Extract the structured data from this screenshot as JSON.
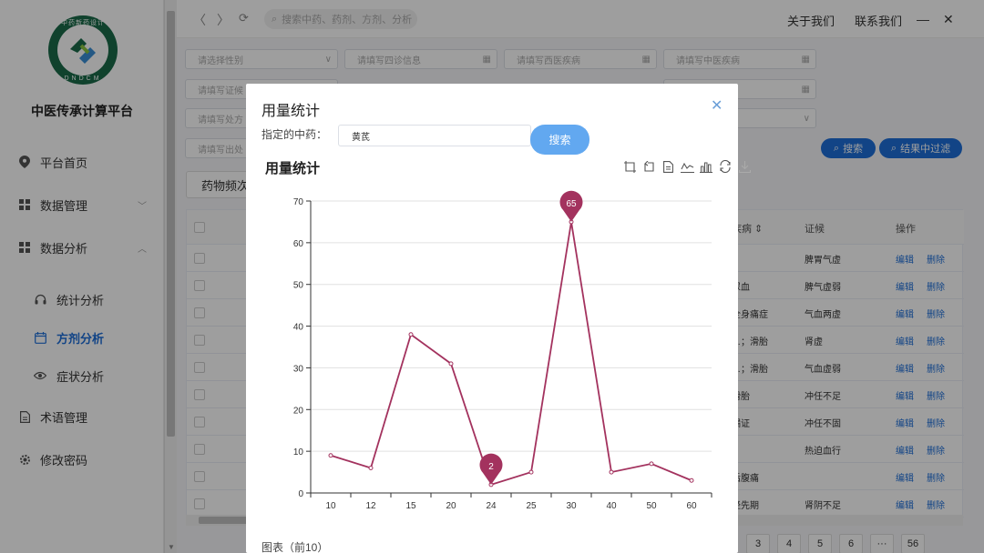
{
  "sidebar": {
    "brand": "中医传承计算平台",
    "logo": {
      "ring_top": "中药新药设计",
      "ring_bottom": "DNDCM"
    },
    "items": [
      {
        "label": "平台首页",
        "icon": "location-pin-icon"
      },
      {
        "label": "数据管理",
        "icon": "grid-icon"
      },
      {
        "label": "数据分析",
        "icon": "grid-icon"
      },
      {
        "label": "统计分析",
        "icon": "headset-icon"
      },
      {
        "label": "方剂分析",
        "icon": "calendar-icon"
      },
      {
        "label": "症状分析",
        "icon": "eye-icon"
      },
      {
        "label": "术语管理",
        "icon": "document-icon"
      },
      {
        "label": "修改密码",
        "icon": "gear-icon"
      }
    ]
  },
  "topbar": {
    "search_placeholder": "搜索中药、药剂、方剂、分析",
    "links": [
      "关于我们",
      "联系我们"
    ]
  },
  "filters": {
    "row1": [
      "请选择性别",
      "请填写四诊信息",
      "请填写西医疾病",
      "请填写中医疾病"
    ],
    "row2": [
      "请填写证候"
    ],
    "row3": [
      "请填写处方"
    ],
    "row4": [
      "请填写出处"
    ],
    "search_btn": "搜索",
    "filter_btn": "结果中过滤"
  },
  "tab_chip": "药物频次",
  "table": {
    "headers": [
      "疾病",
      "证候",
      "操作"
    ],
    "rows": [
      {
        "disease": "",
        "syndrome": "脾胃气虚"
      },
      {
        "disease": "尿血",
        "syndrome": "脾气虚弱"
      },
      {
        "disease": "全身痛症",
        "syndrome": "气血两虚"
      },
      {
        "disease": "…；滑胎",
        "syndrome": "肾虚"
      },
      {
        "disease": "…；滑胎",
        "syndrome": "气血虚弱"
      },
      {
        "disease": "滑胎",
        "syndrome": "冲任不足"
      },
      {
        "disease": "漏证",
        "syndrome": "冲任不固"
      },
      {
        "disease": "",
        "syndrome": "热迫血行"
      },
      {
        "disease": "后腹痛",
        "syndrome": ""
      },
      {
        "disease": "经先期",
        "syndrome": "肾阴不足"
      }
    ],
    "edit": "编辑",
    "delete": "删除"
  },
  "pager": [
    "3",
    "4",
    "5",
    "6",
    "···",
    "56"
  ],
  "modal": {
    "title": "用量统计",
    "label": "指定的中药：",
    "input_value": "黄芪",
    "search_btn": "搜索",
    "footer": "图表（前10）"
  },
  "colors": {
    "accent": "#1e6fd9",
    "series": "#a3325e",
    "search_btn": "#62a8f0"
  },
  "chart_data": {
    "type": "line",
    "title": "用量统计",
    "categories": [
      "10",
      "12",
      "15",
      "20",
      "24",
      "25",
      "30",
      "40",
      "50",
      "60"
    ],
    "values": [
      9,
      6,
      38,
      31,
      2,
      5,
      65,
      5,
      7,
      3
    ],
    "ylim": [
      0,
      70
    ],
    "yticks": [
      0,
      10,
      20,
      30,
      40,
      50,
      60,
      70
    ],
    "markpoints": [
      {
        "type": "max",
        "category": "30",
        "value": 65
      },
      {
        "type": "min",
        "category": "24",
        "value": 2
      }
    ],
    "grid": true,
    "xlabel": "",
    "ylabel": ""
  }
}
